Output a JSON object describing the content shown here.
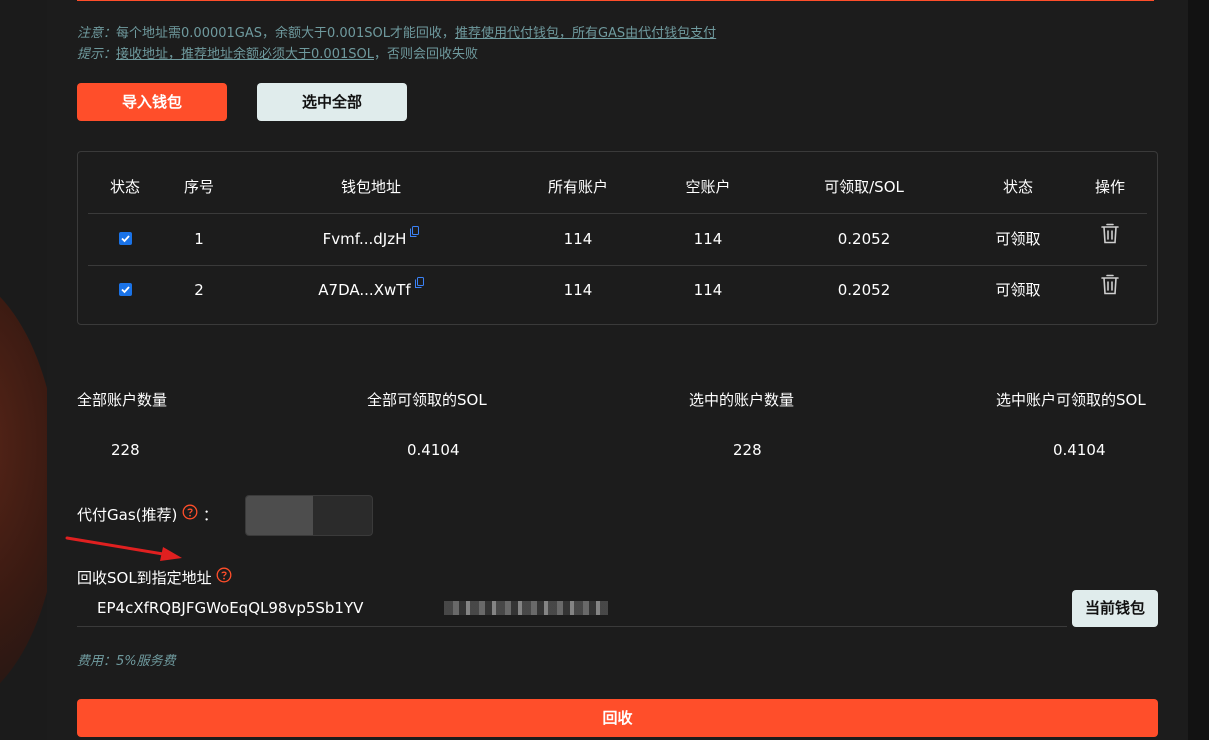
{
  "notices": {
    "note_prefix": "注意：",
    "note_text": "每个地址需0.00001GAS，余额大于0.001SOL才能回收，",
    "note_link": "推荐使用代付钱包，所有GAS由代付钱包支付",
    "tip_prefix": "提示：",
    "tip_link": "接收地址，推荐地址余额必须大于0.001SOL",
    "tip_suffix": "，否则会回收失败"
  },
  "buttons": {
    "import_label": "导入钱包",
    "select_all_label": "选中全部",
    "current_wallet_label": "当前钱包",
    "recover_label": "回收"
  },
  "table": {
    "headers": [
      "状态",
      "序号",
      "钱包地址",
      "所有账户",
      "空账户",
      "可领取/SOL",
      "状态",
      "操作"
    ],
    "rows": [
      {
        "checked": true,
        "index": "1",
        "address": "Fvmf...dJzH",
        "all_accounts": "114",
        "empty_accounts": "114",
        "claimable": "0.2052",
        "status": "可领取"
      },
      {
        "checked": true,
        "index": "2",
        "address": "A7DA...XwTf",
        "all_accounts": "114",
        "empty_accounts": "114",
        "claimable": "0.2052",
        "status": "可领取"
      }
    ]
  },
  "stats": {
    "total_accounts_label": "全部账户数量",
    "total_accounts_value": "228",
    "total_claimable_label": "全部可领取的SOL",
    "total_claimable_value": "0.4104",
    "selected_accounts_label": "选中的账户数量",
    "selected_accounts_value": "228",
    "selected_claimable_label": "选中账户可领取的SOL",
    "selected_claimable_value": "0.4104"
  },
  "gas": {
    "label": "代付Gas(推荐)",
    "colon": "：",
    "toggle_on": false
  },
  "recipient": {
    "label": "回收SOL到指定地址",
    "address_visible": "EP4cXfRQBJFGWoEqQL98vp5Sb1YV"
  },
  "fee_text": "费用：5%服务费",
  "colors": {
    "accent": "#ff4e2a",
    "muted_text": "#6f9a9e",
    "light_button": "#e0ecec",
    "checkbox": "#1a73e8"
  },
  "icons": {
    "copy": "copy-icon",
    "trash": "trash-icon",
    "help": "help-icon",
    "arrow": "red-arrow-annotation"
  }
}
